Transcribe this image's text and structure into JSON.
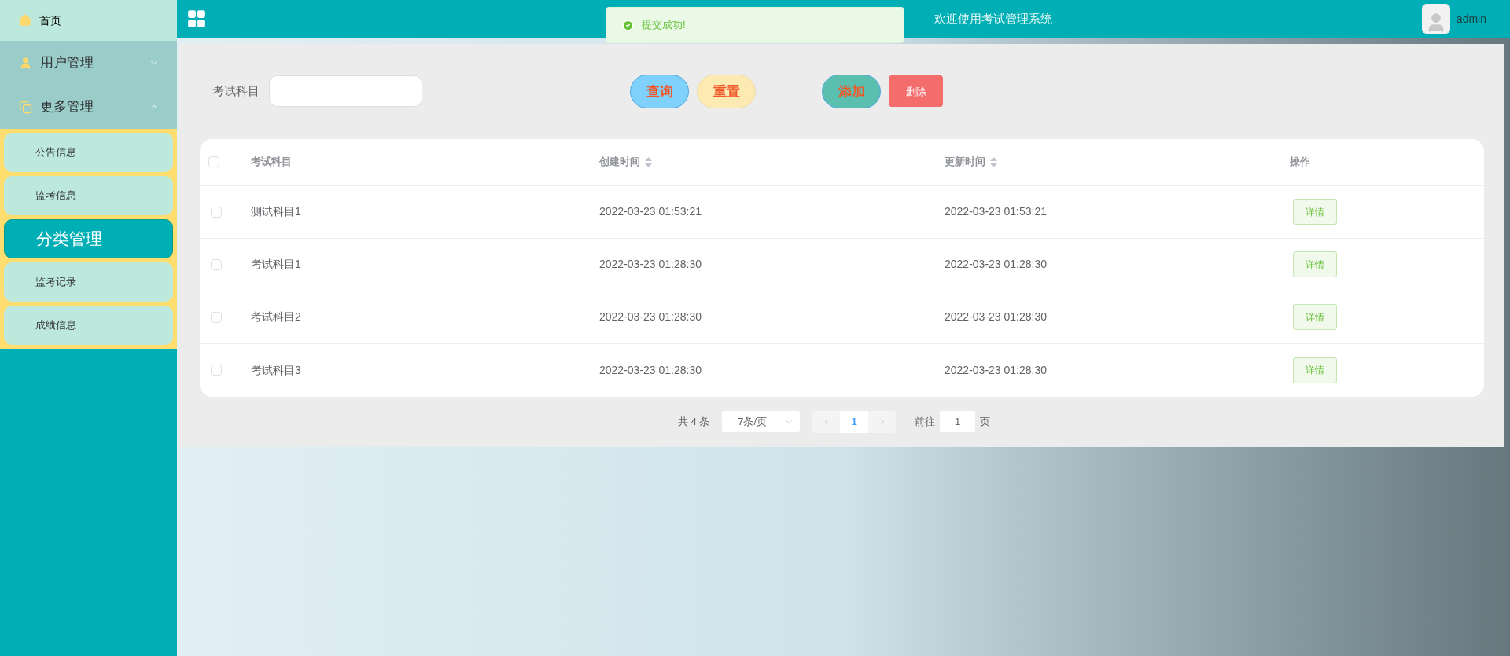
{
  "header": {
    "title": "欢迎使用考试管理系统",
    "user": "admin"
  },
  "toast": {
    "message": "提交成功!"
  },
  "sidebar": {
    "items": [
      {
        "label": "首页",
        "kind": "link"
      },
      {
        "label": "用户管理",
        "kind": "group",
        "expanded": false
      },
      {
        "label": "更多管理",
        "kind": "group",
        "expanded": true,
        "children": [
          {
            "label": "公告信息",
            "selected": false
          },
          {
            "label": "监考信息",
            "selected": false
          },
          {
            "label": "分类管理",
            "selected": true
          },
          {
            "label": "监考记录",
            "selected": false
          },
          {
            "label": "成绩信息",
            "selected": false
          }
        ]
      }
    ]
  },
  "search": {
    "label": "考试科目"
  },
  "buttons": [
    {
      "label": "查询",
      "kind": "query"
    },
    {
      "label": "重置",
      "kind": "reset"
    },
    {
      "label": "添加",
      "kind": "add"
    },
    {
      "label": "删除",
      "kind": "delete"
    }
  ],
  "table": {
    "all_checked": false,
    "columns": [
      {
        "label": "考试科目",
        "sortable": false
      },
      {
        "label": "创建时间",
        "sortable": true
      },
      {
        "label": "更新时间",
        "sortable": true
      },
      {
        "label": "操作",
        "sortable": false
      }
    ],
    "rows": [
      {
        "checked": false,
        "subject": "测试科目1",
        "created": "2022-03-23 01:53:21",
        "updated": "2022-03-23 01:53:21",
        "action": "详情"
      },
      {
        "checked": false,
        "subject": "考试科目1",
        "created": "2022-03-23 01:28:30",
        "updated": "2022-03-23 01:28:30",
        "action": "详情"
      },
      {
        "checked": false,
        "subject": "考试科目2",
        "created": "2022-03-23 01:28:30",
        "updated": "2022-03-23 01:28:30",
        "action": "详情"
      },
      {
        "checked": false,
        "subject": "考试科目3",
        "created": "2022-03-23 01:28:30",
        "updated": "2022-03-23 01:28:30",
        "action": "详情"
      }
    ]
  },
  "pagination": {
    "total": "共 4 条",
    "page_size": "7条/页",
    "pages": [
      {
        "label": "1",
        "selected": true
      }
    ],
    "goto_label": "前往",
    "goto_value": "1",
    "goto_suffix": "页"
  }
}
